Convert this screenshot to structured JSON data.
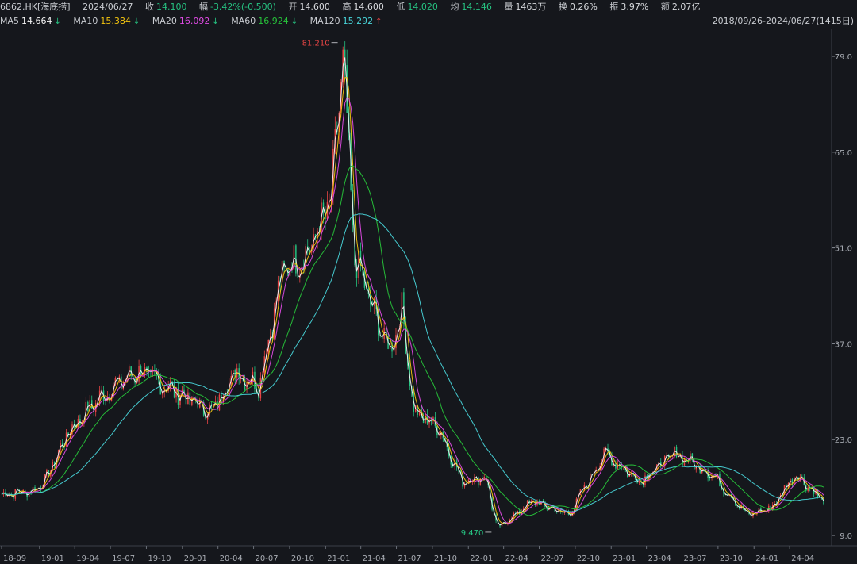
{
  "header": {
    "symbol": "6862.HK[海底捞]",
    "date": "2024/06/27",
    "close_label": "收",
    "close": "14.100",
    "change_label": "幅",
    "change": "-3.42%(-0.500)",
    "open_label": "开",
    "open": "14.600",
    "high_label": "高",
    "high": "14.600",
    "low_label": "低",
    "low": "14.020",
    "avg_label": "均",
    "avg": "14.146",
    "volume_label": "量",
    "volume": "1463万",
    "turnover_label": "换",
    "turnover": "0.26%",
    "amplitude_label": "振",
    "amplitude": "3.97%",
    "amount_label": "额",
    "amount": "2.07亿"
  },
  "ma_row": {
    "ma5_label": "MA5",
    "ma5": "14.664",
    "ma5_dir": "↓",
    "ma10_label": "MA10",
    "ma10": "15.384",
    "ma10_dir": "↓",
    "ma20_label": "MA20",
    "ma20": "16.092",
    "ma20_dir": "↓",
    "ma60_label": "MA60",
    "ma60": "16.924",
    "ma60_dir": "↓",
    "ma120_label": "MA120",
    "ma120": "15.292",
    "ma120_dir": "↑"
  },
  "range_text": "2018/09/26-2024/06/27(1415日)",
  "colors": {
    "background": "#15171c",
    "up": "#e84545",
    "down": "#26c281",
    "ma5": "#f5f5f5",
    "ma10": "#f2c40f",
    "ma20": "#e14be6",
    "ma60": "#27c43a",
    "ma120": "#48d3d8",
    "grid": "#2a2e36"
  },
  "chart_data": {
    "type": "line",
    "description_of_marks": "daily candlesticks with 5 moving-average lines",
    "x_ticks": [
      "18-09",
      "19-01",
      "19-04",
      "19-07",
      "19-10",
      "20-01",
      "20-04",
      "20-07",
      "20-10",
      "21-01",
      "21-04",
      "21-07",
      "21-10",
      "22-01",
      "22-04",
      "22-07",
      "22-10",
      "23-01",
      "23-04",
      "23-07",
      "23-10",
      "24-01",
      "24-04"
    ],
    "y_ticks": [
      "79.0",
      "65.0",
      "51.0",
      "37.0",
      "23.0",
      "9.0"
    ],
    "ylim": [
      9.0,
      79.0
    ],
    "y_scale": "linear",
    "grid": false,
    "annotations": [
      {
        "text": "81.210",
        "kind": "max",
        "x": "21-02",
        "y": 81.21
      },
      {
        "text": "9.470",
        "kind": "min",
        "x": "22-03",
        "y": 9.47
      }
    ],
    "price_path": [
      [
        "2018-09",
        15.0
      ],
      [
        "2018-12",
        15.5
      ],
      [
        "2019-01",
        17.0
      ],
      [
        "2019-03",
        24.0
      ],
      [
        "2019-05",
        28.0
      ],
      [
        "2019-07",
        31.0
      ],
      [
        "2019-09",
        33.0
      ],
      [
        "2019-11",
        31.0
      ],
      [
        "2020-01",
        29.0
      ],
      [
        "2020-03",
        27.0
      ],
      [
        "2020-05",
        33.0
      ],
      [
        "2020-07",
        31.0
      ],
      [
        "2020-09",
        48.0
      ],
      [
        "2020-11",
        50.0
      ],
      [
        "2021-01",
        58.0
      ],
      [
        "2021-02",
        79.0
      ],
      [
        "2021-03",
        50.0
      ],
      [
        "2021-05",
        40.0
      ],
      [
        "2021-06",
        36.0
      ],
      [
        "2021-07",
        42.0
      ],
      [
        "2021-08",
        27.0
      ],
      [
        "2021-10",
        25.0
      ],
      [
        "2021-12",
        17.0
      ],
      [
        "2022-02",
        17.5
      ],
      [
        "2022-03",
        10.0
      ],
      [
        "2022-06",
        14.0
      ],
      [
        "2022-09",
        12.0
      ],
      [
        "2022-12",
        21.0
      ],
      [
        "2023-03",
        17.0
      ],
      [
        "2023-06",
        21.0
      ],
      [
        "2023-09",
        18.0
      ],
      [
        "2023-12",
        12.0
      ],
      [
        "2024-02",
        13.0
      ],
      [
        "2024-04",
        18.0
      ],
      [
        "2024-06",
        14.1
      ]
    ],
    "series": [
      {
        "name": "MA5",
        "values": []
      },
      {
        "name": "MA10",
        "values": []
      },
      {
        "name": "MA20",
        "values": []
      },
      {
        "name": "MA60",
        "values": []
      },
      {
        "name": "MA120",
        "values": []
      }
    ]
  }
}
